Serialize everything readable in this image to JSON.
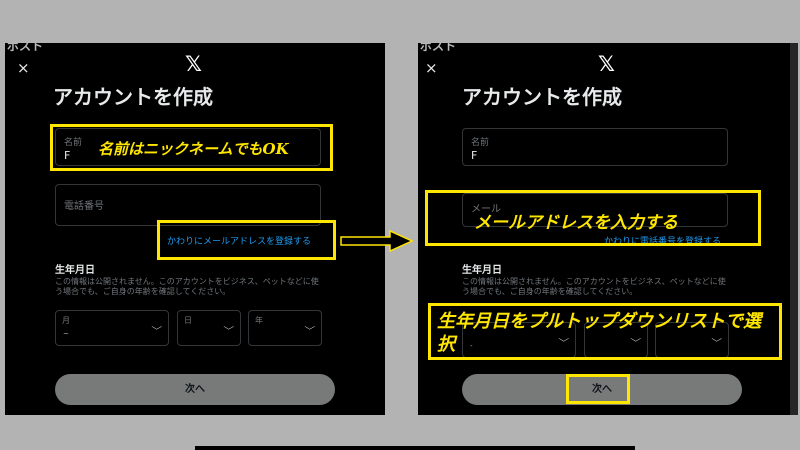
{
  "header_fragment": "ポスト",
  "left": {
    "close": "×",
    "logo": "𝕏",
    "title": "アカウントを作成",
    "name_label": "名前",
    "name_value": "F",
    "phone_label": "電話番号",
    "email_link": "かわりにメールアドレスを登録する",
    "dob_title": "生年月日",
    "dob_desc": "この情報は公開されません。このアカウントをビジネス、ペットなどに使う場合でも、ご自身の年齢を確認してください。",
    "month_label": "月",
    "day_label": "日",
    "year_label": "年",
    "month_value": "~",
    "next": "次へ",
    "annotation": "名前はニックネームでもOK"
  },
  "right": {
    "close": "×",
    "logo": "𝕏",
    "title": "アカウントを作成",
    "name_label": "名前",
    "name_value": "F",
    "email_label": "メール",
    "phone_link": "かわりに電話番号を登録する",
    "dob_title": "生年月日",
    "dob_desc": "この情報は公開されません。このアカウントをビジネス、ペットなどに使う場合でも、ご自身の年齢を確認してください。",
    "month_value": "-",
    "next": "次へ",
    "annotation_email": "メールアドレスを入力する",
    "annotation_dob": "生年月日をプルトップダウンリストで選択"
  },
  "icons": {
    "chevron": "chevron-down-icon",
    "arrow": "right-arrow-icon"
  },
  "colors": {
    "annotation": "#ffe600",
    "link": "#1d9bf0",
    "button": "#787a7a",
    "modal_bg": "#000000"
  }
}
